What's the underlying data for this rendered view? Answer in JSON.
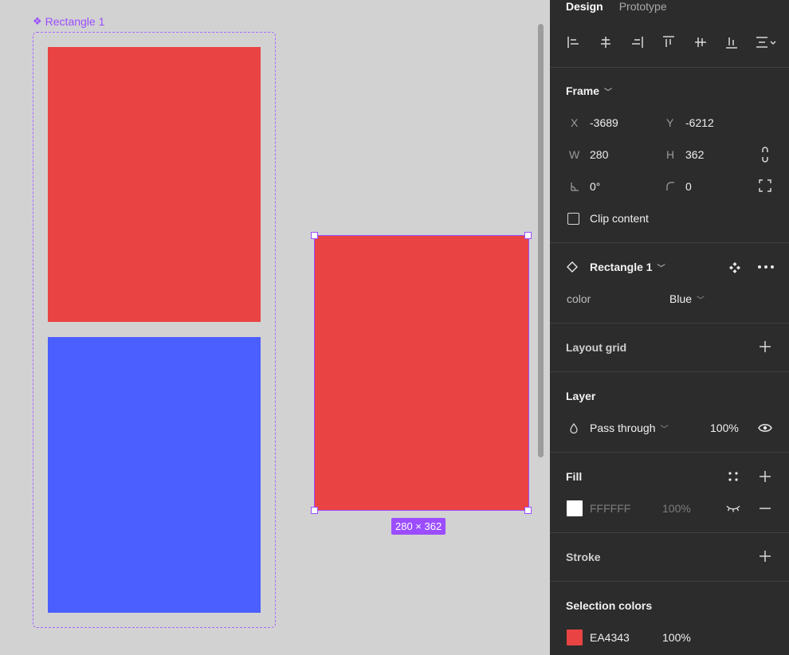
{
  "canvas": {
    "component_label": "Rectangle 1",
    "selection_size": "280 × 362",
    "colors": {
      "red": "#EA4343",
      "blue": "#4B5EFF",
      "selection": "#9B4DFF"
    }
  },
  "panel": {
    "tabs": [
      "Design",
      "Prototype"
    ],
    "frame": {
      "title": "Frame",
      "x_label": "X",
      "x_value": "-3689",
      "y_label": "Y",
      "y_value": "-6212",
      "w_label": "W",
      "w_value": "280",
      "h_label": "H",
      "h_value": "362",
      "rotation": "0°",
      "radius": "0",
      "clip_content": "Clip content"
    },
    "instance": {
      "name": "Rectangle 1",
      "prop_label": "color",
      "prop_value": "Blue"
    },
    "layout_grid": {
      "title": "Layout grid"
    },
    "layer": {
      "title": "Layer",
      "blend": "Pass through",
      "opacity": "100%"
    },
    "fill": {
      "title": "Fill",
      "hex": "FFFFFF",
      "opacity": "100%",
      "swatch": "#FFFFFF"
    },
    "stroke": {
      "title": "Stroke"
    },
    "selection_colors": {
      "title": "Selection colors",
      "hex": "EA4343",
      "opacity": "100%",
      "swatch": "#EA4343"
    }
  }
}
